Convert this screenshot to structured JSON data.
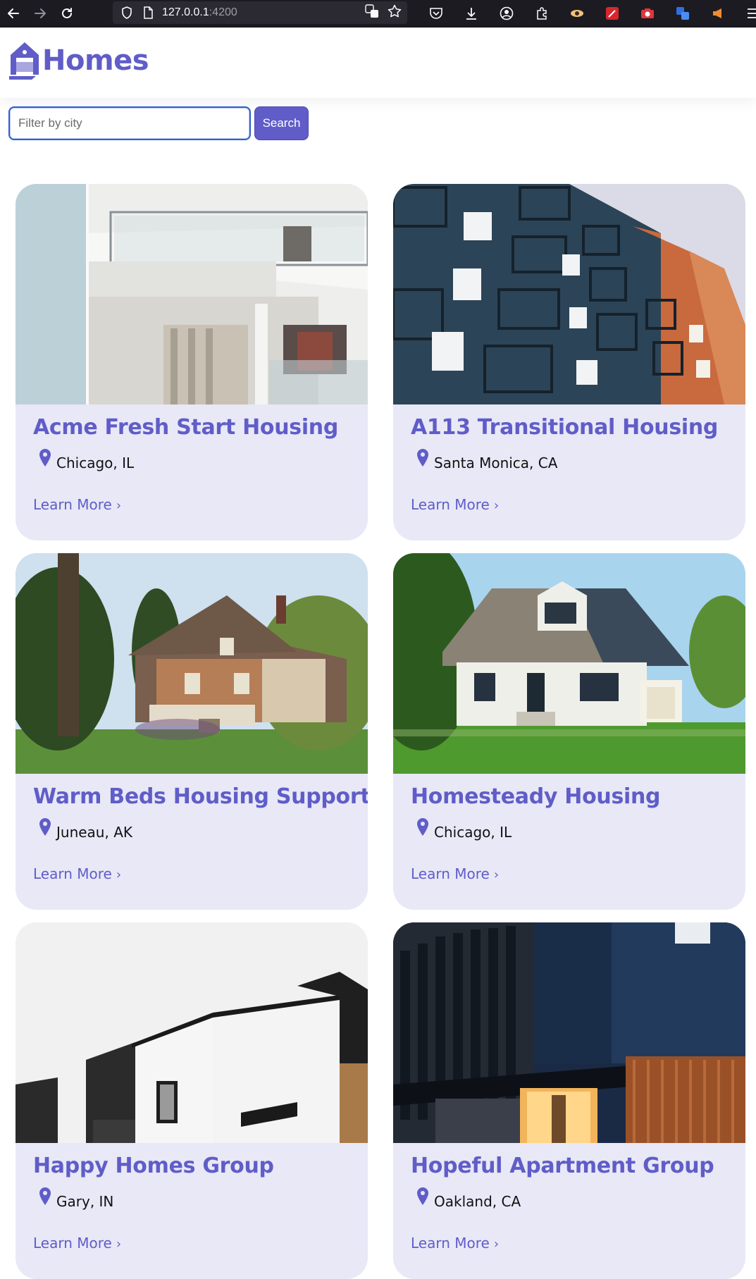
{
  "browser": {
    "url_host": "127.0.0.1",
    "url_port": ":4200"
  },
  "app": {
    "brand_name": "Homes",
    "brand_color": "#605dc8"
  },
  "search": {
    "placeholder": "Filter by city",
    "value": "",
    "button_label": "Search"
  },
  "listings": [
    {
      "name": "Acme Fresh Start Housing",
      "location": "Chicago, IL",
      "link_label": "Learn More",
      "photo": "white-modern-balcony-building"
    },
    {
      "name": "A113 Transitional Housing",
      "location": "Santa Monica, CA",
      "link_label": "Learn More",
      "photo": "blue-orange-apartment-balconies"
    },
    {
      "name": "Warm Beds Housing Support",
      "location": "Juneau, AK",
      "link_label": "Learn More",
      "photo": "victorian-brick-house"
    },
    {
      "name": "Homesteady Housing",
      "location": "Chicago, IL",
      "link_label": "Learn More",
      "photo": "white-suburban-house"
    },
    {
      "name": "Happy Homes Group",
      "location": "Gary, IN",
      "link_label": "Learn More",
      "photo": "black-white-modern-house"
    },
    {
      "name": "Hopeful Apartment Group",
      "location": "Oakland, CA",
      "link_label": "Learn More",
      "photo": "dark-modern-building-night"
    }
  ],
  "icons": {
    "location": "location-pin-icon",
    "chevron": "chevron-right-icon"
  }
}
